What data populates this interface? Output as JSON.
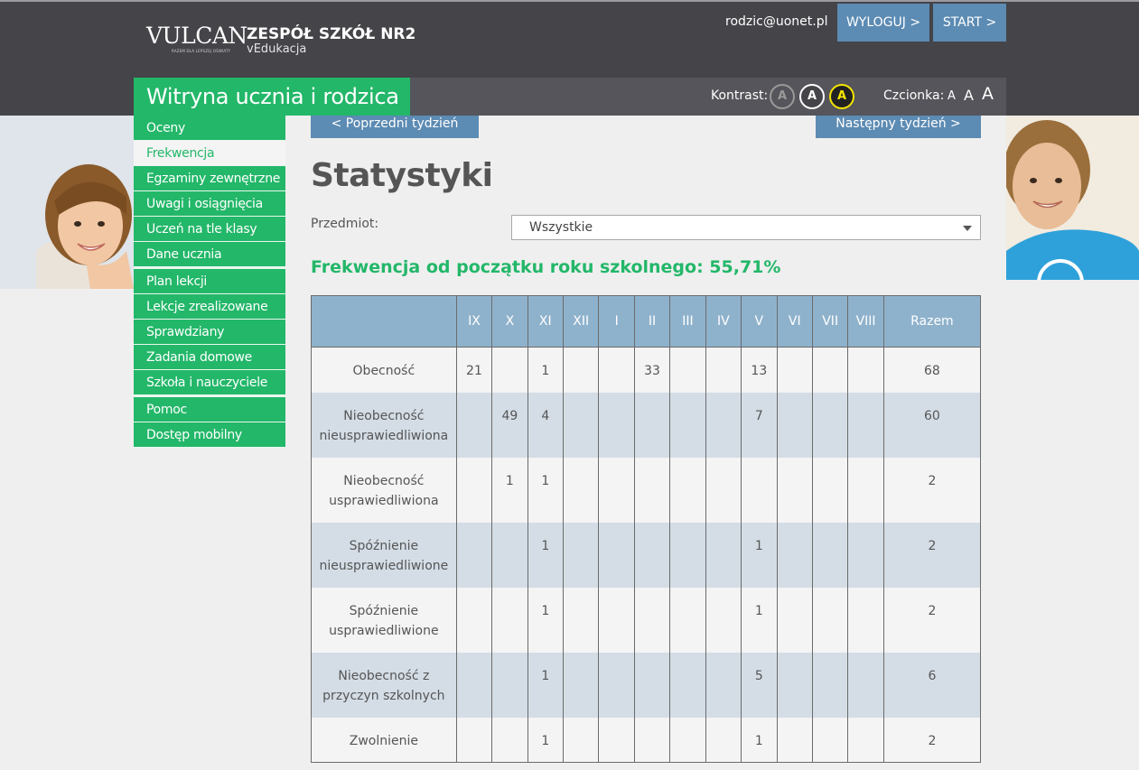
{
  "header": {
    "logo_text": "VULCAN",
    "logo_tagline": "RAZEM DLA LEPSZEJ OŚWIATY",
    "school_name": "ZESPÓŁ SZKÓŁ NR2",
    "school_sub": "vEdukacja",
    "user_email": "rodzic@uonet.pl",
    "logout_label": "WYLOGUJ >",
    "start_label": "START >",
    "site_title": "Witryna ucznia i rodzica",
    "contrast_label": "Kontrast:",
    "contrast_options": [
      "A",
      "A",
      "A"
    ],
    "font_label": "Czcionka:",
    "font_options": [
      "A",
      "A",
      "A"
    ]
  },
  "menu": {
    "items": [
      {
        "label": "Oceny"
      },
      {
        "label": "Frekwencja"
      },
      {
        "label": "Egzaminy zewnętrzne"
      },
      {
        "label": "Uwagi i osiągnięcia"
      },
      {
        "label": "Uczeń na tle klasy"
      },
      {
        "label": "Dane ucznia"
      },
      {
        "label": "Plan lekcji"
      },
      {
        "label": "Lekcje zrealizowane"
      },
      {
        "label": "Sprawdziany"
      },
      {
        "label": "Zadania domowe"
      },
      {
        "label": "Szkoła i nauczyciele"
      },
      {
        "label": "Pomoc"
      },
      {
        "label": "Dostęp mobilny"
      }
    ],
    "active_item": "Frekwencja"
  },
  "main": {
    "prev_week": "< Poprzedni tydzień",
    "next_week": "Następny tydzień >",
    "title": "Statystyki",
    "subject_label": "Przedmiot:",
    "subject_selected": "Wszystkie",
    "summary": "Frekwencja od początku roku szkolnego: 55,71%"
  },
  "table": {
    "months": [
      "IX",
      "X",
      "XI",
      "XII",
      "I",
      "II",
      "III",
      "IV",
      "V",
      "VI",
      "VII",
      "VIII"
    ],
    "total_header": "Razem",
    "rows": [
      {
        "label": "Obecność",
        "values": [
          "21",
          "",
          "1",
          "",
          "",
          "33",
          "",
          "",
          "13",
          "",
          "",
          ""
        ],
        "total": "68"
      },
      {
        "label": "Nieobecność nieusprawiedliwiona",
        "values": [
          "",
          "49",
          "4",
          "",
          "",
          "",
          "",
          "",
          "7",
          "",
          "",
          ""
        ],
        "total": "60"
      },
      {
        "label": "Nieobecność usprawiedliwiona",
        "values": [
          "",
          "1",
          "1",
          "",
          "",
          "",
          "",
          "",
          "",
          "",
          "",
          ""
        ],
        "total": "2"
      },
      {
        "label": "Spóźnienie nieusprawiedliwione",
        "values": [
          "",
          "",
          "1",
          "",
          "",
          "",
          "",
          "",
          "1",
          "",
          "",
          ""
        ],
        "total": "2"
      },
      {
        "label": "Spóźnienie usprawiedliwione",
        "values": [
          "",
          "",
          "1",
          "",
          "",
          "",
          "",
          "",
          "1",
          "",
          "",
          ""
        ],
        "total": "2"
      },
      {
        "label": "Nieobecność z przyczyn szkolnych",
        "values": [
          "",
          "",
          "1",
          "",
          "",
          "",
          "",
          "",
          "5",
          "",
          "",
          ""
        ],
        "total": "6"
      },
      {
        "label": "Zwolnienie",
        "values": [
          "",
          "",
          "1",
          "",
          "",
          "",
          "",
          "",
          "1",
          "",
          "",
          ""
        ],
        "total": "2"
      }
    ]
  },
  "colors": {
    "green": "#23b769",
    "blue_button": "#5c8bb3",
    "table_header": "#8fb2cc",
    "row_alt": "#d4dde6",
    "header_bg": "#444449"
  }
}
